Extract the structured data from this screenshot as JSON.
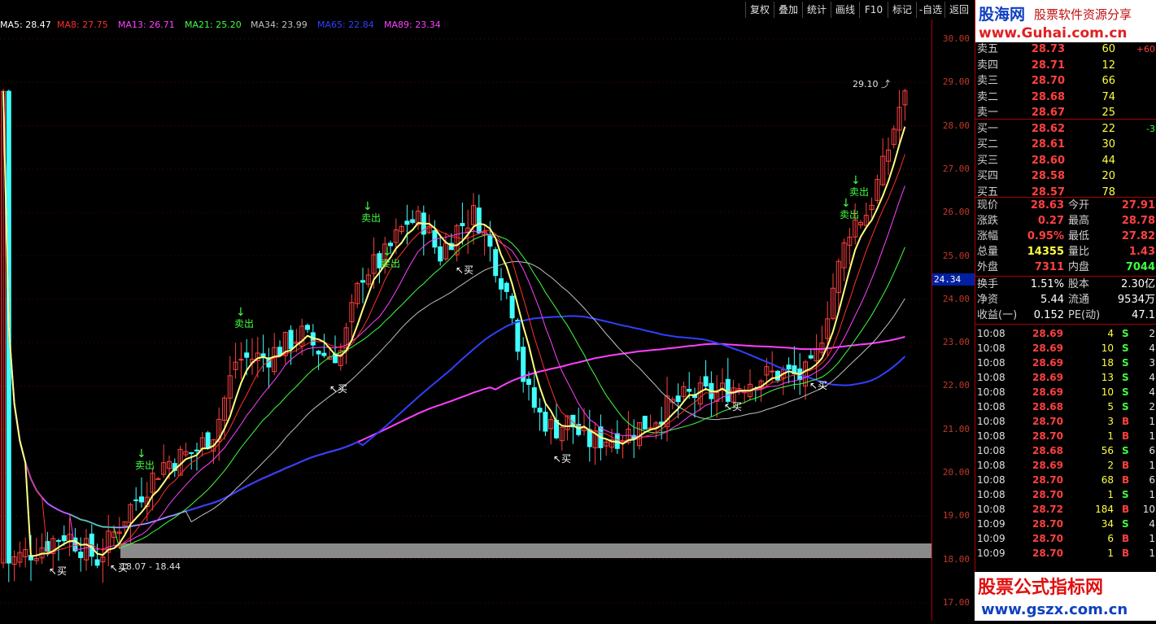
{
  "toolbar": {
    "buttons": [
      "复权",
      "叠加",
      "统计",
      "画线",
      "F10",
      "标记",
      "-自选",
      "返回"
    ]
  },
  "ma_legend": [
    {
      "label": "MA5: 28.47",
      "color": "#ffffff"
    },
    {
      "label": "MA8: 27.75",
      "color": "#ff3030"
    },
    {
      "label": "MA13: 26.71",
      "color": "#ff40ff"
    },
    {
      "label": "MA21: 25.20",
      "color": "#40ff40"
    },
    {
      "label": "MA34: 23.99",
      "color": "#c0c0c0"
    },
    {
      "label": "MA65: 22.84",
      "color": "#3040ff"
    },
    {
      "label": "MA89: 23.34",
      "color": "#ff40ff"
    }
  ],
  "y_axis": {
    "ticks": [
      "30.00",
      "29.00",
      "28.00",
      "27.00",
      "26.00",
      "25.00",
      "24.00",
      "23.00",
      "22.00",
      "21.00",
      "20.00",
      "19.00",
      "18.00",
      "17.00"
    ],
    "cursor_value": "24.34"
  },
  "chart": {
    "high_label": "29.10",
    "range_label": "18.07 - 18.44",
    "signals": [
      {
        "kind": "sell",
        "text": "卖出"
      },
      {
        "kind": "sell",
        "text": "卖出"
      },
      {
        "kind": "sell",
        "text": "卖出"
      },
      {
        "kind": "sell",
        "text": "卖出"
      },
      {
        "kind": "sell",
        "text": "卖出"
      },
      {
        "kind": "sell",
        "text": "卖出"
      },
      {
        "kind": "buy",
        "text": "买"
      },
      {
        "kind": "buy",
        "text": "买"
      },
      {
        "kind": "buy",
        "text": "买"
      },
      {
        "kind": "buy",
        "text": "买"
      },
      {
        "kind": "buy",
        "text": "买"
      },
      {
        "kind": "buy",
        "text": "买"
      },
      {
        "kind": "buy",
        "text": "买"
      }
    ]
  },
  "logo_top": {
    "brand": "股海网",
    "slogan": "股票软件资源分享",
    "url": "www.Guhai.com.cn"
  },
  "logo_bottom": {
    "title": "股票公式指标网",
    "url": "www.gszx.com.cn"
  },
  "order_book": {
    "asks": [
      {
        "label": "卖五",
        "price": "28.73",
        "vol": "60",
        "extra": "+60"
      },
      {
        "label": "卖四",
        "price": "28.71",
        "vol": "12",
        "extra": ""
      },
      {
        "label": "卖三",
        "price": "28.70",
        "vol": "66",
        "extra": ""
      },
      {
        "label": "卖二",
        "price": "28.68",
        "vol": "74",
        "extra": ""
      },
      {
        "label": "卖一",
        "price": "28.67",
        "vol": "25",
        "extra": ""
      }
    ],
    "bids": [
      {
        "label": "买一",
        "price": "28.62",
        "vol": "22",
        "extra": "-3"
      },
      {
        "label": "买二",
        "price": "28.61",
        "vol": "30",
        "extra": ""
      },
      {
        "label": "买三",
        "price": "28.60",
        "vol": "44",
        "extra": ""
      },
      {
        "label": "买四",
        "price": "28.58",
        "vol": "20",
        "extra": ""
      },
      {
        "label": "买五",
        "price": "28.57",
        "vol": "78",
        "extra": ""
      }
    ]
  },
  "quote": [
    {
      "l1": "现价",
      "v1": "28.63",
      "c1": "#ff4040",
      "l2": "今开",
      "v2": "27.91",
      "c2": "#ff4040"
    },
    {
      "l1": "涨跌",
      "v1": "0.27",
      "c1": "#ff4040",
      "l2": "最高",
      "v2": "28.78",
      "c2": "#ff4040"
    },
    {
      "l1": "涨幅",
      "v1": "0.95%",
      "c1": "#ff4040",
      "l2": "最低",
      "v2": "27.82",
      "c2": "#ff4040"
    },
    {
      "l1": "总量",
      "v1": "14355",
      "c1": "#ffff40",
      "l2": "量比",
      "v2": "1.43",
      "c2": "#ff4040"
    },
    {
      "l1": "外盘",
      "v1": "7311",
      "c1": "#ff4040",
      "l2": "内盘",
      "v2": "7044",
      "c2": "#40ff40"
    }
  ],
  "fundamentals": [
    {
      "l1": "换手",
      "v1": "1.51%",
      "l2": "股本",
      "v2": "2.30亿"
    },
    {
      "l1": "净资",
      "v1": "5.44",
      "l2": "流通",
      "v2": "9534万"
    },
    {
      "l1": "收益(一)",
      "v1": "0.152",
      "l2": "PE(动)",
      "v2": "47.1"
    }
  ],
  "ticks": [
    {
      "time": "10:08",
      "price": "28.69",
      "vol": "4",
      "side": "S",
      "n": "2"
    },
    {
      "time": "10:08",
      "price": "28.69",
      "vol": "10",
      "side": "S",
      "n": "4"
    },
    {
      "time": "10:08",
      "price": "28.69",
      "vol": "18",
      "side": "S",
      "n": "3"
    },
    {
      "time": "10:08",
      "price": "28.69",
      "vol": "13",
      "side": "S",
      "n": "4"
    },
    {
      "time": "10:08",
      "price": "28.69",
      "vol": "10",
      "side": "S",
      "n": "4"
    },
    {
      "time": "10:08",
      "price": "28.68",
      "vol": "5",
      "side": "S",
      "n": "2"
    },
    {
      "time": "10:08",
      "price": "28.70",
      "vol": "3",
      "side": "B",
      "n": "1"
    },
    {
      "time": "10:08",
      "price": "28.70",
      "vol": "1",
      "side": "B",
      "n": "1"
    },
    {
      "time": "10:08",
      "price": "28.68",
      "vol": "56",
      "side": "S",
      "n": "6"
    },
    {
      "time": "10:08",
      "price": "28.69",
      "vol": "2",
      "side": "B",
      "n": "1"
    },
    {
      "time": "10:08",
      "price": "28.70",
      "vol": "68",
      "side": "B",
      "n": "6"
    },
    {
      "time": "10:08",
      "price": "28.70",
      "vol": "1",
      "side": "S",
      "n": "1"
    },
    {
      "time": "10:08",
      "price": "28.72",
      "vol": "184",
      "side": "B",
      "n": "10"
    },
    {
      "time": "10:09",
      "price": "28.70",
      "vol": "34",
      "side": "S",
      "n": "4"
    },
    {
      "time": "10:09",
      "price": "28.70",
      "vol": "6",
      "side": "B",
      "n": "1"
    },
    {
      "time": "10:09",
      "price": "28.70",
      "vol": "1",
      "side": "B",
      "n": "1"
    }
  ],
  "colors": {
    "up": "#ff4040",
    "down": "#40ffff",
    "buy": "#ff4040",
    "sell": "#40ff40"
  }
}
